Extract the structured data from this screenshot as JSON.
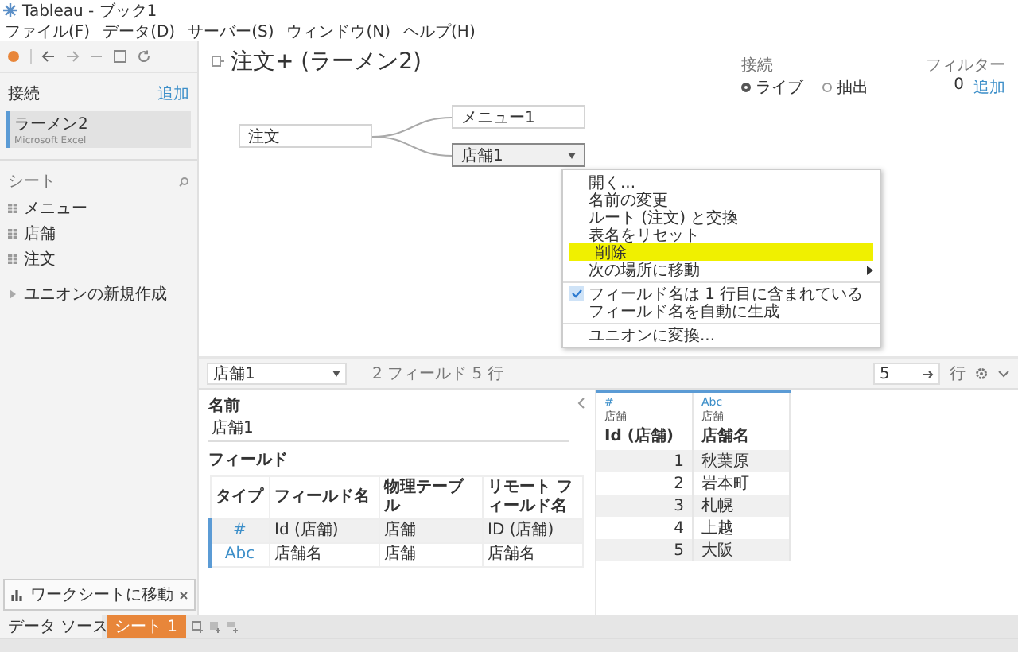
{
  "window": {
    "title": "Tableau - ブック1"
  },
  "menu_bar": [
    "ファイル(F)",
    "データ(D)",
    "サーバー(S)",
    "ウィンドウ(N)",
    "ヘルプ(H)"
  ],
  "sidebar": {
    "connections_label": "接続",
    "add_link": "追加",
    "connections": [
      {
        "name": "ラーメン2",
        "type": "Microsoft Excel",
        "selected": true
      }
    ],
    "sheets_label": "シート",
    "sheets": [
      "メニュー",
      "店舗",
      "注文"
    ],
    "new_union": "ユニオンの新規作成"
  },
  "canvas": {
    "title": "注文+ (ラーメン2)",
    "connection_label": "接続",
    "connection_modes": [
      {
        "label": "ライブ",
        "selected": true
      },
      {
        "label": "抽出",
        "selected": false
      }
    ],
    "filter_label": "フィルター",
    "filter_count": "0",
    "filter_add": "追加",
    "tables": [
      {
        "name": "注文",
        "selected": false
      },
      {
        "name": "メニュー1",
        "selected": false
      },
      {
        "name": "店舗1",
        "selected": true
      }
    ]
  },
  "context_menu": [
    {
      "label": "開く...",
      "highlighted": false,
      "checked": false,
      "submenu": false,
      "separator_before": false
    },
    {
      "label": "名前の変更",
      "highlighted": false,
      "checked": false,
      "submenu": false,
      "separator_before": false
    },
    {
      "label": "ルート (注文) と交換",
      "highlighted": false,
      "checked": false,
      "submenu": false,
      "separator_before": false
    },
    {
      "label": "表名をリセット",
      "highlighted": false,
      "checked": false,
      "submenu": false,
      "separator_before": false
    },
    {
      "label": "削除",
      "highlighted": true,
      "checked": false,
      "submenu": false,
      "separator_before": false
    },
    {
      "label": "次の場所に移動",
      "highlighted": false,
      "checked": false,
      "submenu": true,
      "separator_before": false
    },
    {
      "label": "フィールド名は 1 行目に含まれている",
      "highlighted": false,
      "checked": true,
      "submenu": false,
      "separator_before": true
    },
    {
      "label": "フィールド名を自動に生成",
      "highlighted": false,
      "checked": false,
      "submenu": false,
      "separator_before": false
    },
    {
      "label": "ユニオンに変換...",
      "highlighted": false,
      "checked": false,
      "submenu": false,
      "separator_before": true
    }
  ],
  "bottom_toolbar": {
    "table_select": "店舗1",
    "summary": "2 フィールド 5 行",
    "row_count": "5",
    "rows_label": "行"
  },
  "details": {
    "name_label": "名前",
    "name_value": "店舗1",
    "fields_label": "フィールド",
    "columns": [
      "タイプ",
      "フィールド名",
      "物理テーブル",
      "リモート フィールド名"
    ],
    "rows": [
      [
        "#",
        "Id (店舗)",
        "店舗",
        "ID (店舗)"
      ],
      [
        "Abc",
        "店舗名",
        "店舗",
        "店舗名"
      ]
    ]
  },
  "grid": {
    "columns": [
      {
        "type_icon": "#",
        "table": "店舗",
        "name": "Id (店舗)",
        "kind": "number"
      },
      {
        "type_icon": "Abc",
        "table": "店舗",
        "name": "店舗名",
        "kind": "string"
      }
    ],
    "rows": [
      [
        "1",
        "秋葉原"
      ],
      [
        "2",
        "岩本町"
      ],
      [
        "3",
        "札幌"
      ],
      [
        "4",
        "上越"
      ],
      [
        "5",
        "大阪"
      ]
    ]
  },
  "sheet_tabs": {
    "data_source": "データ ソース",
    "sheets": [
      {
        "label": "シート 1",
        "selected": true
      }
    ]
  },
  "tooltip": {
    "text": "ワークシートに移動"
  }
}
